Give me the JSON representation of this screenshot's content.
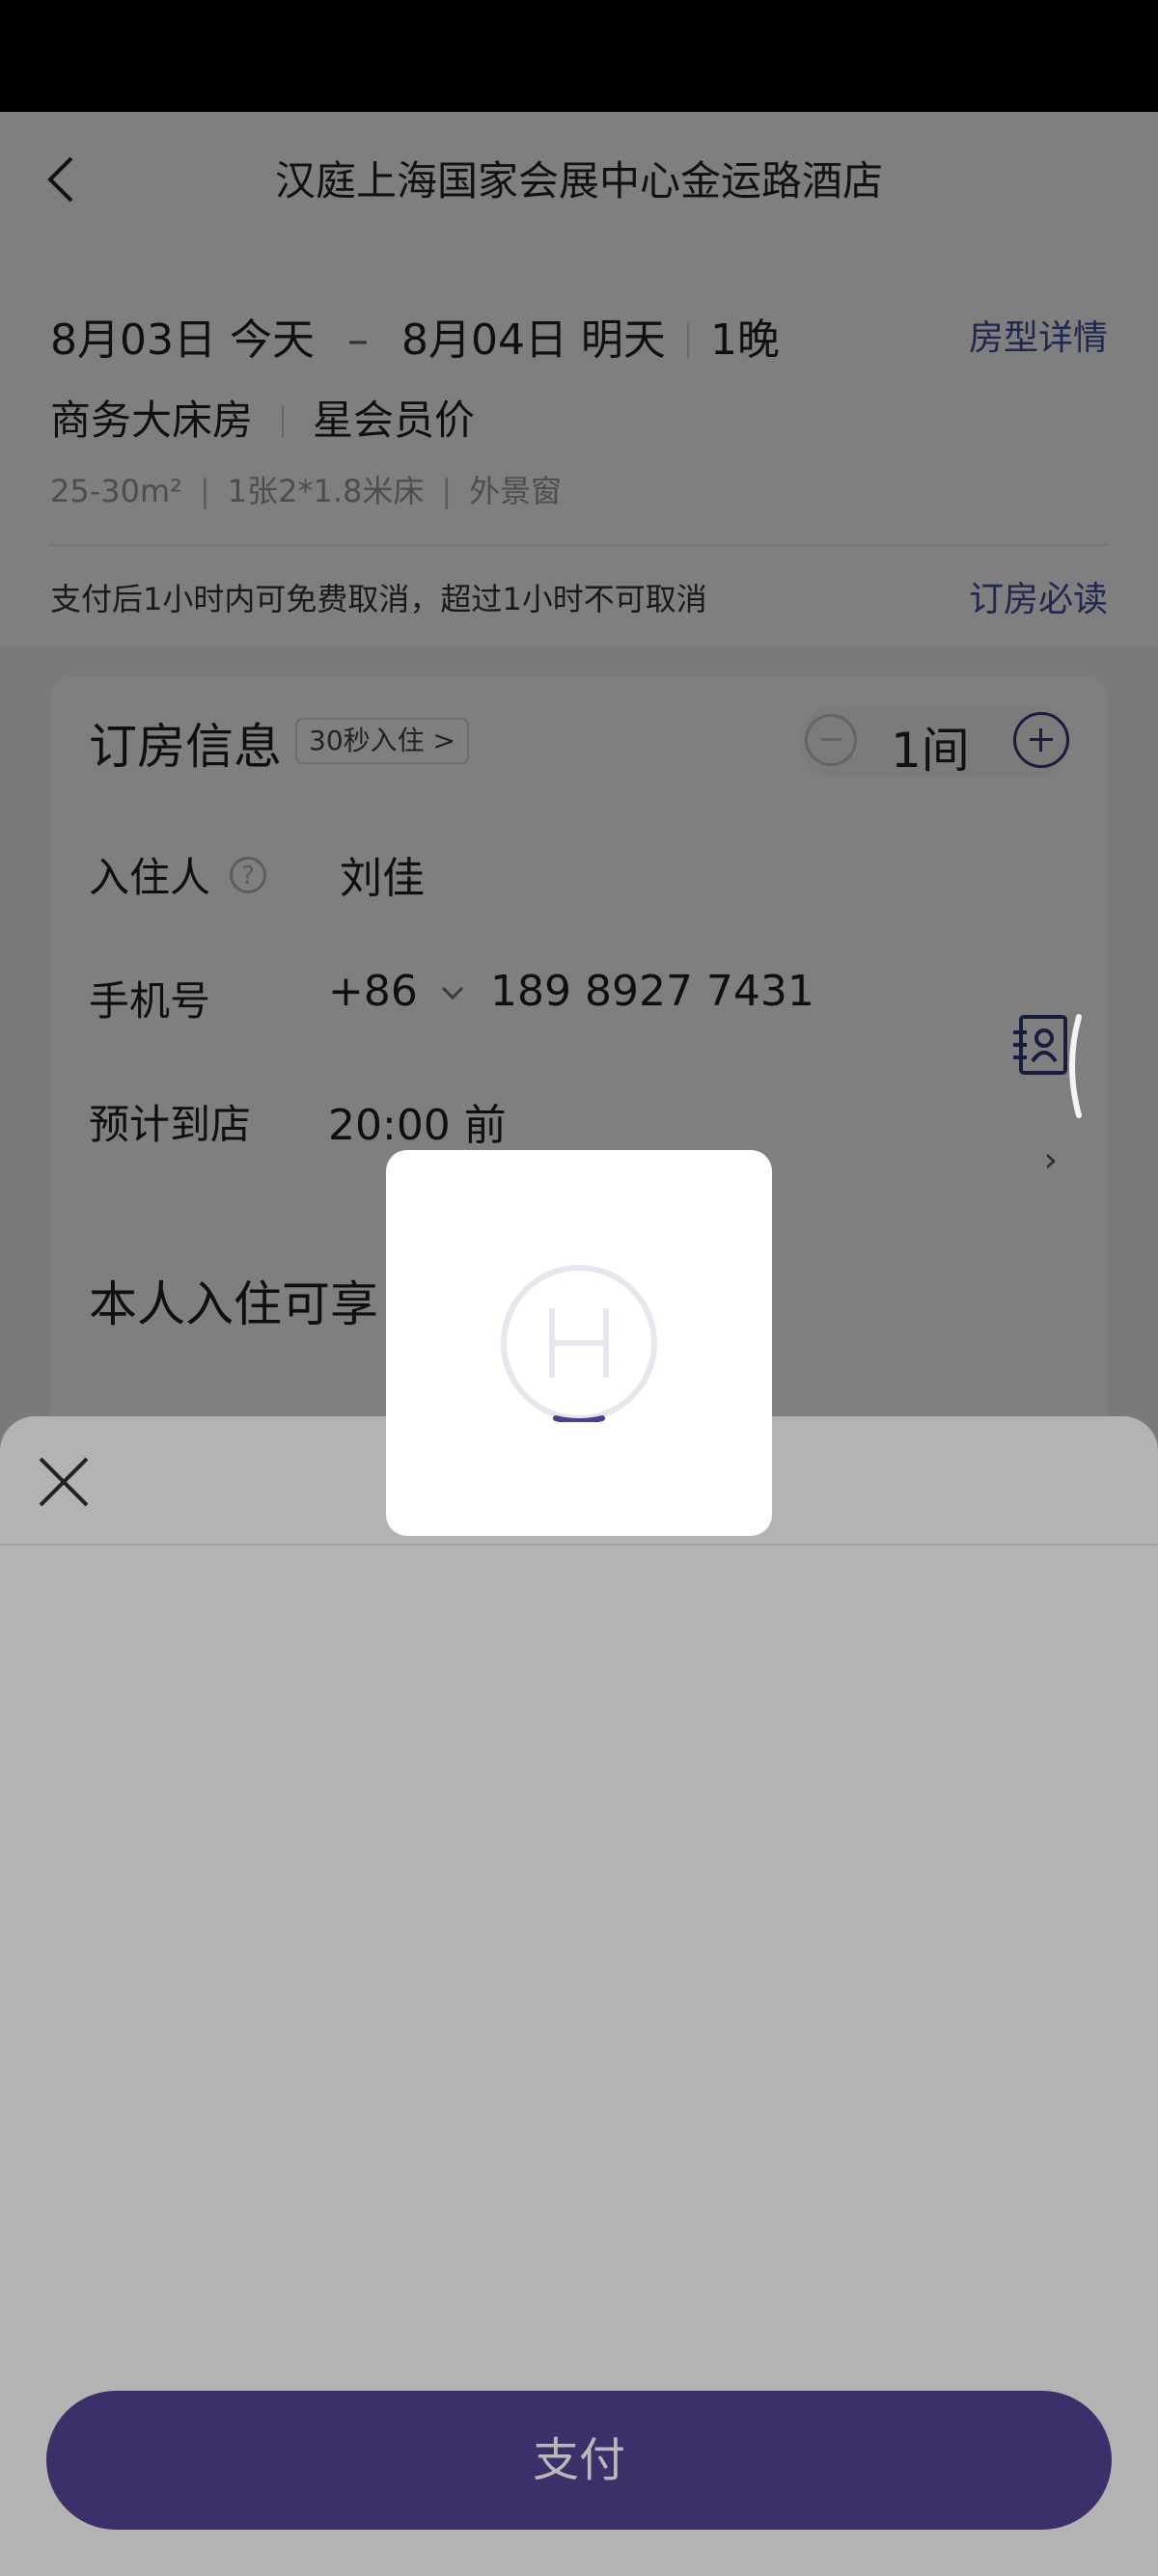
{
  "header": {
    "title": "汉庭上海国家会展中心金运路酒店"
  },
  "stay": {
    "checkin": "8月03日 今天",
    "dash": "–",
    "checkout": "8月04日 明天",
    "nights": "1晚",
    "room_detail_link": "房型详情"
  },
  "room": {
    "type": "商务大床房",
    "price_type": "星会员价",
    "specs": [
      "25-30m²",
      "1张2*1.8米床",
      "外景窗"
    ],
    "cancel_policy": "支付后1小时内可免费取消，超过1小时不可取消",
    "must_read_link": "订房必读"
  },
  "booking": {
    "title": "订房信息",
    "chip": "30秒入住 >",
    "quantity": "1间",
    "guest_label": "入住人",
    "guest_name": "刘佳",
    "phone_label": "手机号",
    "country_code": "+86",
    "phone": "189 8927 7431",
    "arrival_label": "预计到店",
    "arrival_time": "20:00 前"
  },
  "benefits": {
    "title": "本人入住可享"
  },
  "sheet": {
    "pay_label": "支付"
  },
  "colors": {
    "accent": "#3d4e9e",
    "pay_button": "#3d2f69"
  },
  "icons": [
    "back-arrow-icon",
    "help-icon",
    "minus-icon",
    "plus-icon",
    "contacts-icon",
    "chevron-right-icon",
    "close-icon",
    "hotel-logo-icon"
  ]
}
